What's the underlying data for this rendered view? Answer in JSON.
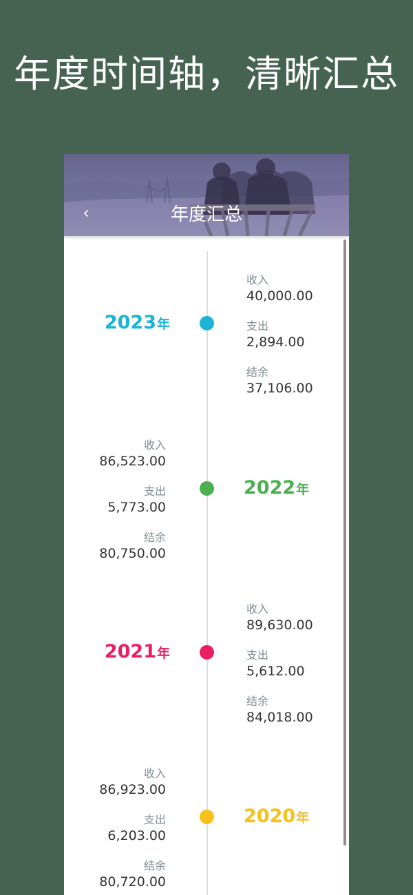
{
  "promo": {
    "title": "年度时间轴，清晰汇总"
  },
  "header": {
    "back_icon": "‹",
    "title": "年度汇总"
  },
  "labels": {
    "income": "收入",
    "expense": "支出",
    "balance": "结余",
    "year_suffix": "年"
  },
  "timeline": [
    {
      "year": "2023",
      "color": "#1ab4d6",
      "income": "40,000.00",
      "expense": "2,894.00",
      "balance": "37,106.00"
    },
    {
      "year": "2022",
      "color": "#4caf50",
      "income": "86,523.00",
      "expense": "5,773.00",
      "balance": "80,750.00"
    },
    {
      "year": "2021",
      "color": "#e91e63",
      "income": "89,630.00",
      "expense": "5,612.00",
      "balance": "84,018.00"
    },
    {
      "year": "2020",
      "color": "#f7c01b",
      "income": "86,923.00",
      "expense": "6,203.00",
      "balance": "80,720.00"
    }
  ]
}
